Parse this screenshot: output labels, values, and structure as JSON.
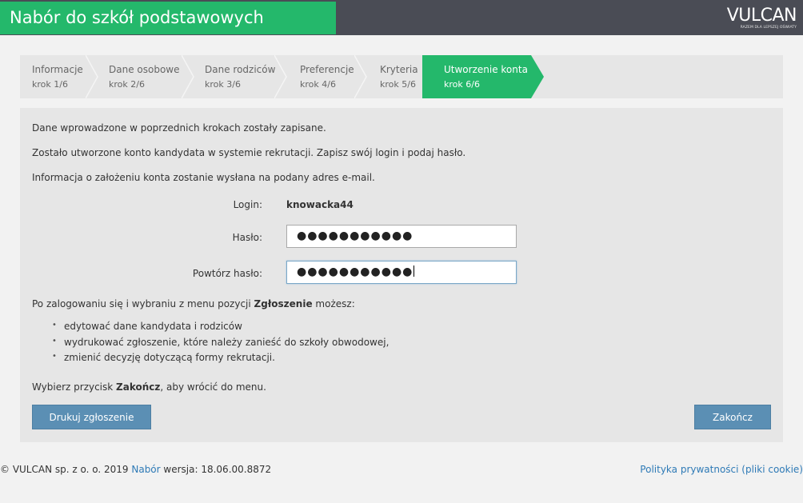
{
  "header": {
    "title": "Nabór do szkół podstawowych",
    "logo_word": "VULCAN",
    "logo_tagline": "RAZEM DLA LEPSZEJ OŚWIATY"
  },
  "colors": {
    "accent": "#24b86b",
    "header_bg": "#4a4c55",
    "button": "#5b8fb4",
    "link": "#2e7ab6"
  },
  "steps": [
    {
      "label": "Informacje",
      "sub": "krok 1/6",
      "active": false
    },
    {
      "label": "Dane osobowe",
      "sub": "krok 2/6",
      "active": false
    },
    {
      "label": "Dane rodziców",
      "sub": "krok 3/6",
      "active": false
    },
    {
      "label": "Preferencje",
      "sub": "krok 4/6",
      "active": false
    },
    {
      "label": "Kryteria",
      "sub": "krok 5/6",
      "active": false
    },
    {
      "label": "Utworzenie konta",
      "sub": "krok 6/6",
      "active": true
    }
  ],
  "panel": {
    "p1": "Dane wprowadzone w poprzednich krokach zostały zapisane.",
    "p2": "Zostało utworzone konto kandydata w systemie rekrutacji. Zapisz swój login i podaj hasło.",
    "p3": "Informacja o założeniu konta zostanie wysłana na podany adres e-mail.",
    "login_label": "Login:",
    "login_value": "knowacka44",
    "password_label": "Hasło:",
    "password_value": "●●●●●●●●●●●",
    "repeat_label": "Powtórz hasło:",
    "repeat_value": "●●●●●●●●●●●",
    "info_prefix": "Po zalogowaniu się i wybraniu z menu pozycji ",
    "info_bold": "Zgłoszenie",
    "info_suffix": " możesz:",
    "items": [
      "edytować dane kandydata i rodziców",
      "wydrukować zgłoszenie, które należy zanieść do szkoły obwodowej,",
      "zmienić decyzję dotyczącą formy rekrutacji."
    ],
    "finish_prefix": "Wybierz przycisk ",
    "finish_bold": "Zakończ",
    "finish_suffix": ", aby wrócić do menu.",
    "print_button": "Drukuj zgłoszenie",
    "finish_button": "Zakończ"
  },
  "footer": {
    "copyright": "© VULCAN sp. z o. o. 2019 ",
    "nabor_link": "Nabór",
    "version": " wersja: 18.06.00.8872",
    "privacy_link": "Polityka prywatności (pliki cookie)"
  }
}
